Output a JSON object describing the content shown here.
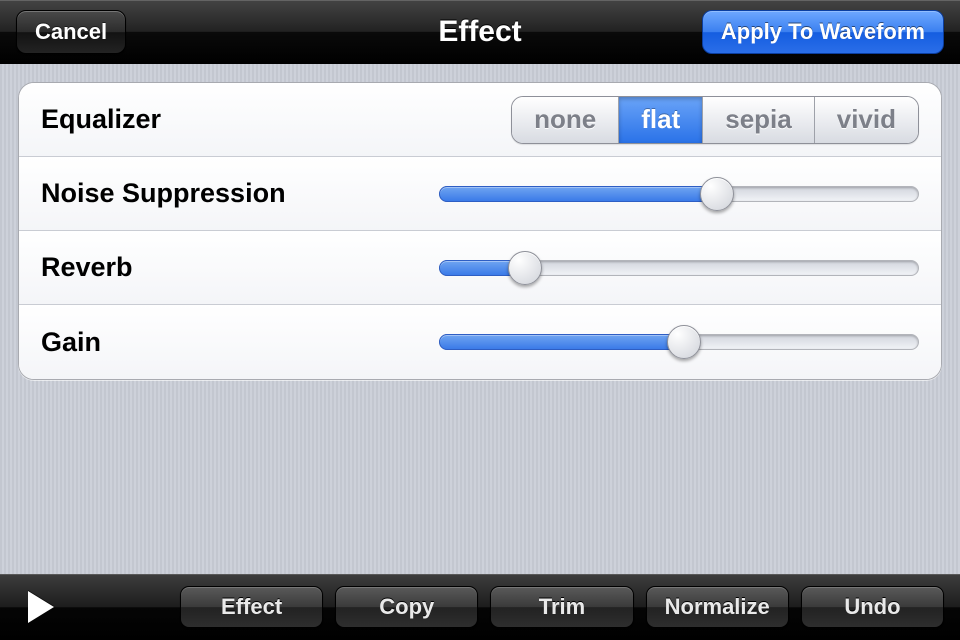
{
  "navbar": {
    "cancel": "Cancel",
    "title": "Effect",
    "apply": "Apply To Waveform"
  },
  "rows": {
    "equalizer": {
      "label": "Equalizer"
    },
    "noise": {
      "label": "Noise Suppression",
      "value_pct": 58
    },
    "reverb": {
      "label": "Reverb",
      "value_pct": 18
    },
    "gain": {
      "label": "Gain",
      "value_pct": 51
    }
  },
  "equalizer_options": {
    "selected_index": 1,
    "items": [
      "none",
      "flat",
      "sepia",
      "vivid"
    ]
  },
  "toolbar": {
    "effect": "Effect",
    "copy": "Copy",
    "trim": "Trim",
    "normalize": "Normalize",
    "undo": "Undo"
  }
}
